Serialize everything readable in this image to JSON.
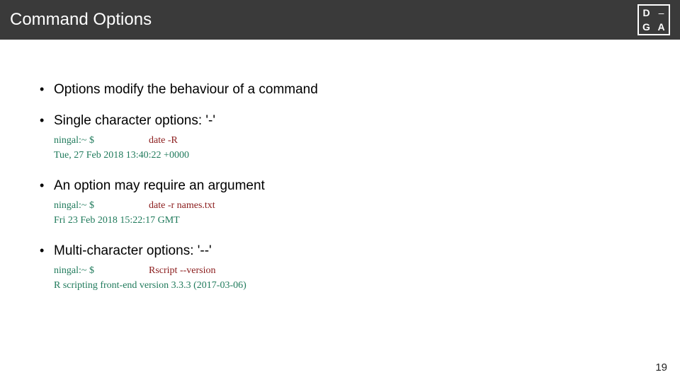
{
  "header": {
    "title": "Command Options",
    "logo": {
      "tl": "D",
      "tr": "–",
      "bl": "G",
      "br": "A"
    }
  },
  "bullets": [
    {
      "text": "Options modify the behaviour of a command",
      "term": null
    },
    {
      "text": "Single character options: '-'",
      "term": {
        "prompt": "ningal:~ $",
        "cmd": "date -R",
        "out": "Tue, 27 Feb 2018 13:40:22 +0000"
      }
    },
    {
      "text": "An option may require an argument",
      "term": {
        "prompt": "ningal:~ $",
        "cmd": "date -r names.txt",
        "out": "Fri 23 Feb 2018 15:22:17 GMT"
      }
    },
    {
      "text": "Multi-character options: '--'",
      "term": {
        "prompt": "ningal:~ $",
        "cmd": "Rscript --version",
        "out": "R scripting front-end version 3.3.3 (2017-03-06)"
      }
    }
  ],
  "page_number": "19"
}
